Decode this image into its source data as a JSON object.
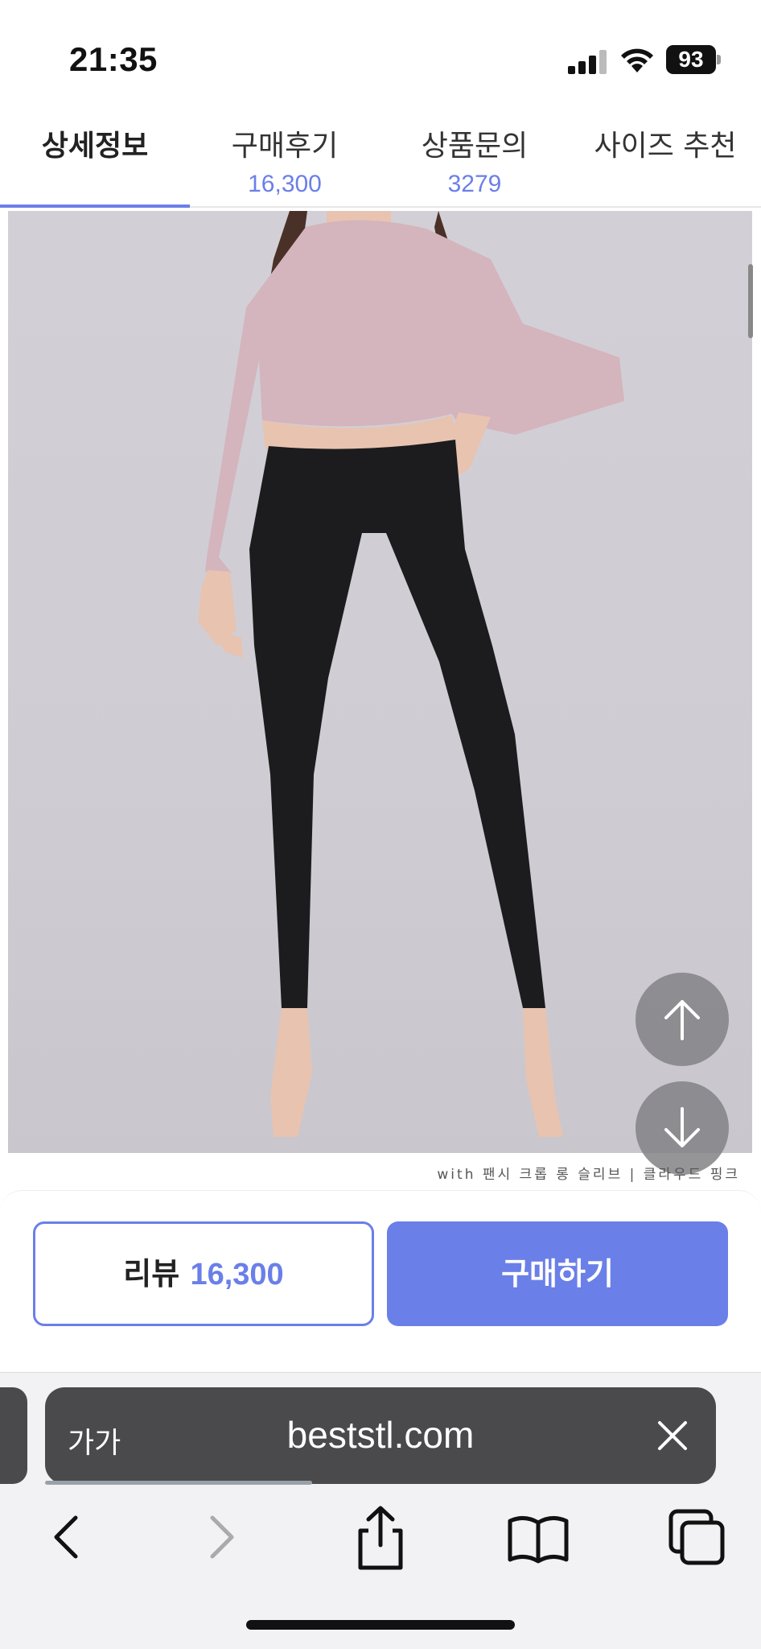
{
  "status_bar": {
    "time": "21:35",
    "battery": "93"
  },
  "tabs": [
    {
      "label": "상세정보",
      "count": ""
    },
    {
      "label": "구매후기",
      "count": "16,300"
    },
    {
      "label": "상품문의",
      "count": "3279"
    },
    {
      "label": "사이즈 추천",
      "count": ""
    }
  ],
  "product": {
    "image": "woman-in-pink-crop-top-and-black-leggings",
    "caption": "with 팬시 크롭 롱 슬리브 | 클라우드 핑크"
  },
  "actions": {
    "review_label": "리뷰",
    "review_count": "16,300",
    "buy_label": "구매하기"
  },
  "browser": {
    "aa_label": "가가",
    "url": "beststl.com"
  },
  "colors": {
    "accent": "#6b7fe8",
    "address_bar": "#4a4a4c"
  },
  "icons": [
    "arrow-up-icon",
    "arrow-down-icon",
    "close-icon",
    "back-icon",
    "forward-icon",
    "share-icon",
    "bookmarks-icon",
    "tabs-icon"
  ]
}
